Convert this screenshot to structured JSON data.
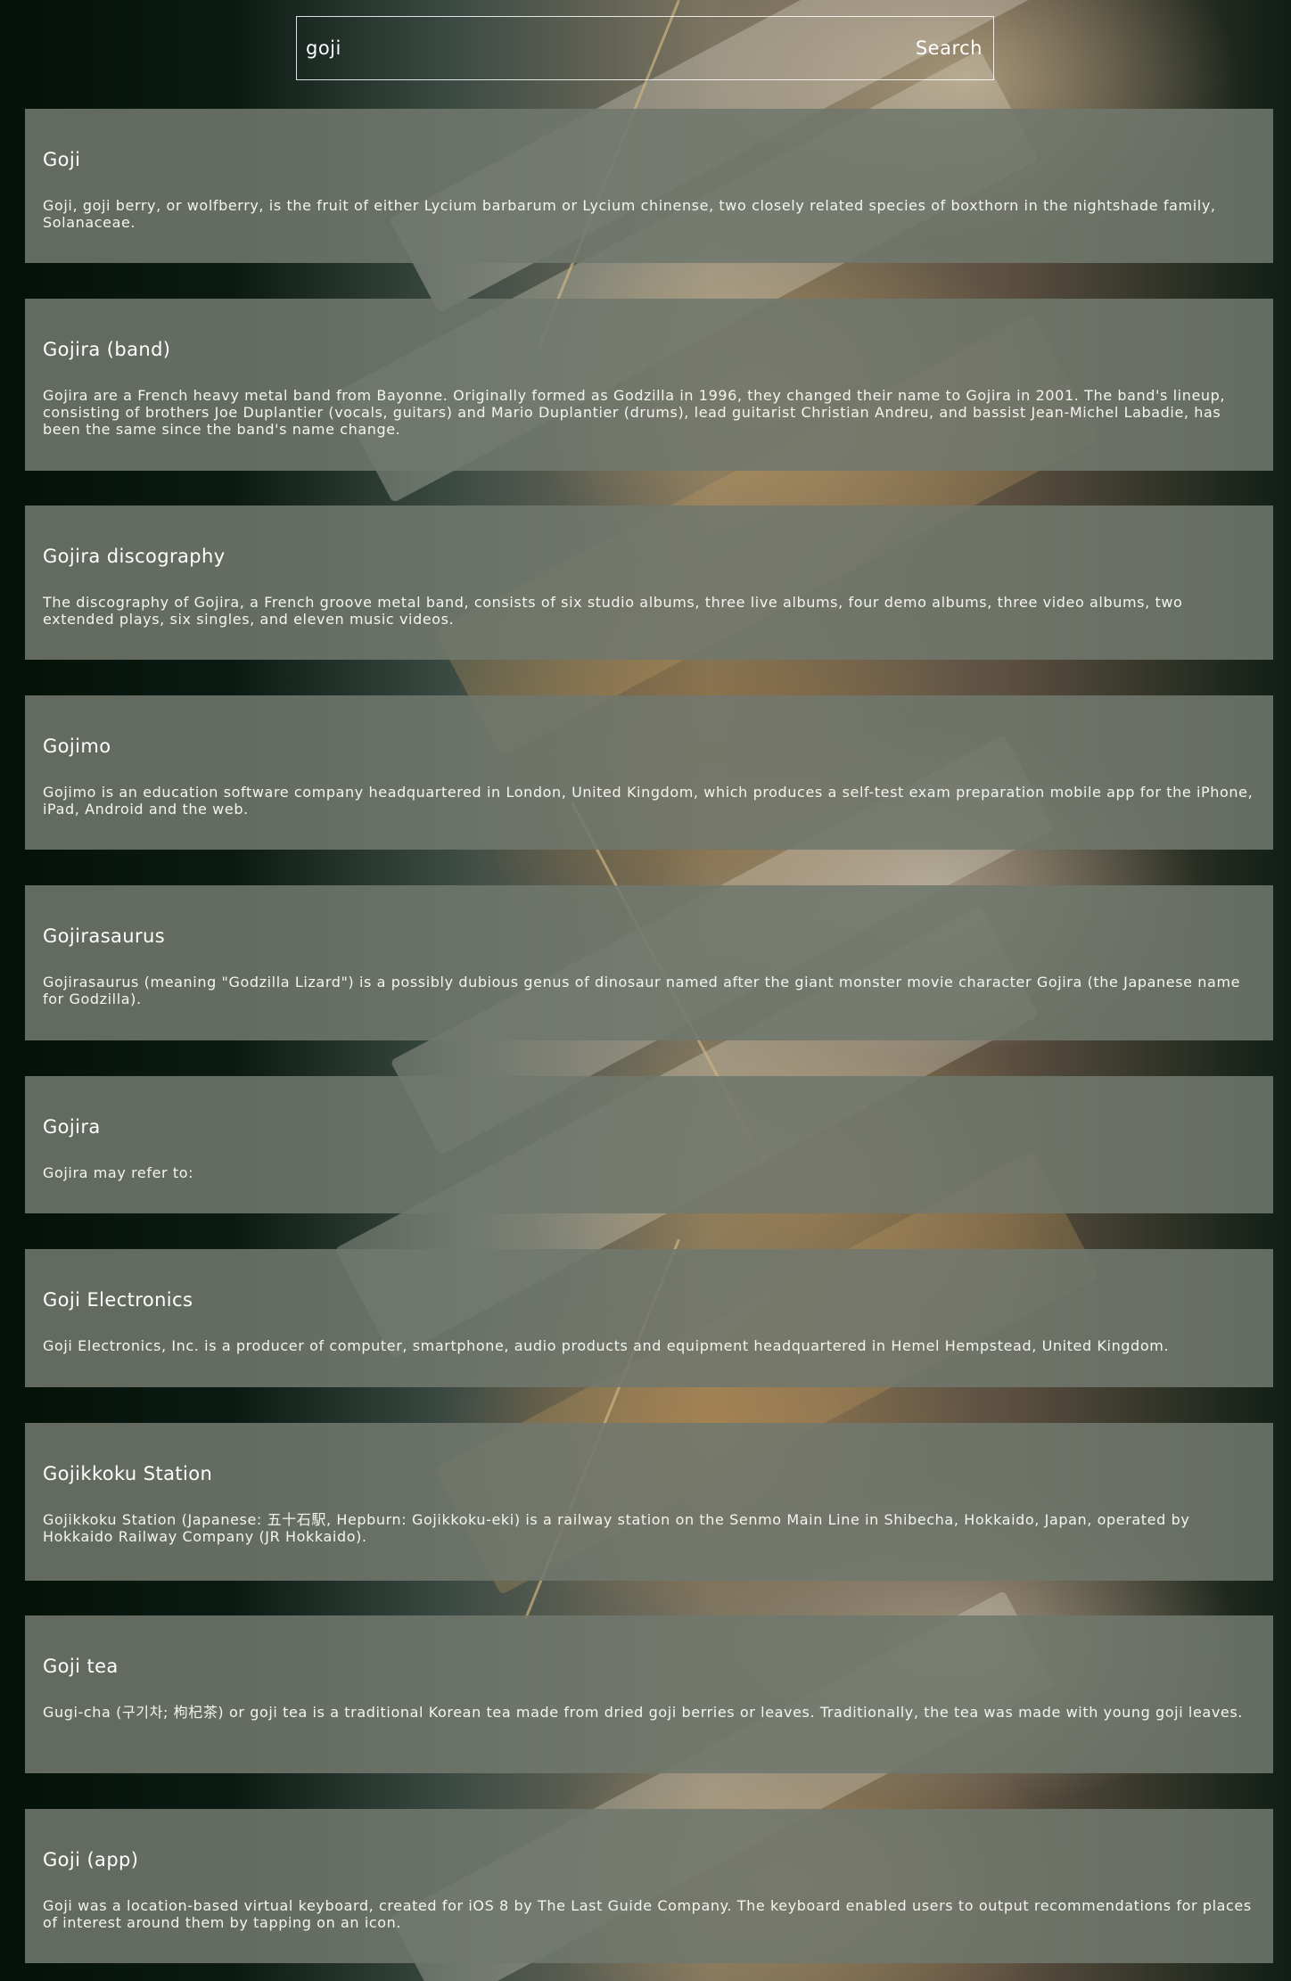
{
  "search": {
    "query": "goji",
    "button_label": "Search"
  },
  "results": [
    {
      "title": "Goji",
      "snippet": "Goji, goji berry, or wolfberry, is the fruit of either Lycium barbarum or Lycium chinense, two closely related species of boxthorn in the nightshade family, Solanaceae."
    },
    {
      "title": "Gojira (band)",
      "snippet": "Gojira are a French heavy metal band from Bayonne. Originally formed as Godzilla in 1996, they changed their name to Gojira in 2001. The band's lineup, consisting of brothers Joe Duplantier (vocals, guitars) and Mario Duplantier (drums), lead guitarist Christian Andreu, and bassist Jean-Michel Labadie, has been the same since the band's name change."
    },
    {
      "title": "Gojira discography",
      "snippet": "The discography of Gojira, a French groove metal band, consists of six studio albums, three live albums, four demo albums, three video albums, two extended plays, six singles, and eleven music videos."
    },
    {
      "title": "Gojimo",
      "snippet": "Gojimo is an education software company headquartered in London, United Kingdom, which produces a self-test exam preparation mobile app for the iPhone, iPad, Android and the web."
    },
    {
      "title": "Gojirasaurus",
      "snippet": "Gojirasaurus (meaning \"Godzilla Lizard\") is a possibly dubious genus of dinosaur named after the giant monster movie character Gojira (the Japanese name for Godzilla)."
    },
    {
      "title": "Gojira",
      "snippet": "Gojira may refer to:"
    },
    {
      "title": "Goji Electronics",
      "snippet": "Goji Electronics, Inc. is a producer of computer, smartphone, audio products and equipment headquartered in Hemel Hempstead, United Kingdom."
    },
    {
      "title": "Gojikkoku Station",
      "snippet": "Gojikkoku Station (Japanese: 五十石駅, Hepburn: Gojikkoku-eki) is a railway station on the Senmo Main Line in Shibecha, Hokkaido, Japan, operated by Hokkaido Railway Company (JR Hokkaido)."
    },
    {
      "title": "Goji tea",
      "snippet": "Gugi-cha (구기차; 枸杞茶) or goji tea is a traditional Korean tea made from dried goji berries or leaves. Traditionally, the tea was made with young goji leaves."
    },
    {
      "title": "Goji (app)",
      "snippet": "Goji was a location-based virtual keyboard, created for iOS 8 by The Last Guide Company. The keyboard enabled users to output recommendations for places of interest around them by tapping on an icon."
    }
  ]
}
